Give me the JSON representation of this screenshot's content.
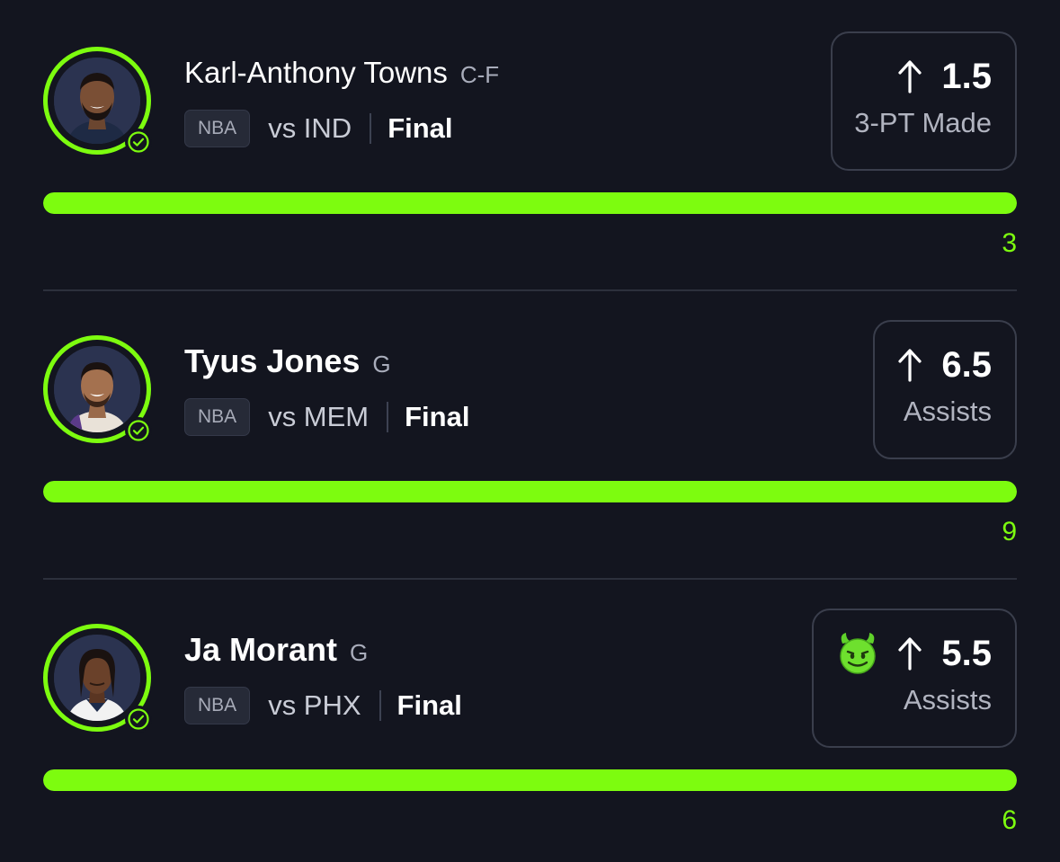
{
  "theme": {
    "background": "#13151f",
    "accent": "#7dfc0f",
    "card_border": "#3a3e4c"
  },
  "picks": [
    {
      "name": "Karl-Anthony Towns",
      "position": "C-F",
      "league": "NBA",
      "opponent": "vs IND",
      "status": "Final",
      "direction_icon": "arrow-up-icon",
      "line": "1.5",
      "stat": "3-PT Made",
      "result": "3",
      "progress_fraction": 1.0,
      "has_emoji": false,
      "checked": true
    },
    {
      "name": "Tyus Jones",
      "position": "G",
      "league": "NBA",
      "opponent": "vs MEM",
      "status": "Final",
      "direction_icon": "arrow-up-icon",
      "line": "6.5",
      "stat": "Assists",
      "result": "9",
      "progress_fraction": 1.0,
      "has_emoji": false,
      "checked": true
    },
    {
      "name": "Ja Morant",
      "position": "G",
      "league": "NBA",
      "opponent": "vs PHX",
      "status": "Final",
      "direction_icon": "arrow-up-icon",
      "line": "5.5",
      "stat": "Assists",
      "result": "6",
      "progress_fraction": 1.0,
      "has_emoji": true,
      "emoji_icon": "smiling-devil-emoji-icon",
      "checked": true
    }
  ]
}
